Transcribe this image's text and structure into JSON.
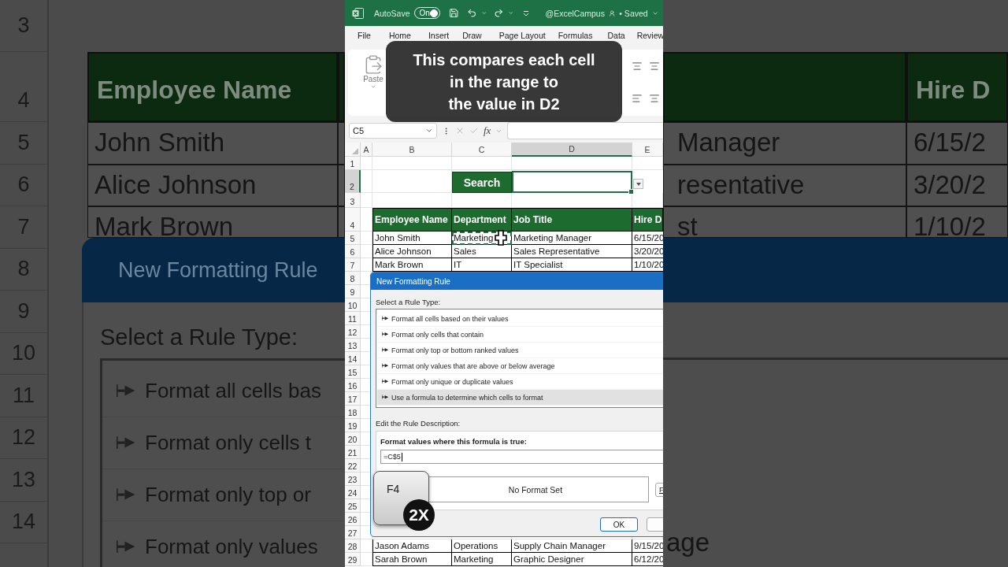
{
  "backdrop_left": {
    "row_numbers": [
      "3",
      "4",
      "5",
      "6",
      "7",
      "8",
      "9",
      "10",
      "11",
      "12",
      "13",
      "14"
    ],
    "table_header": "Employee Name",
    "table_rows": [
      "John Smith",
      "Alice Johnson",
      "Mark Brown"
    ],
    "dialog_title": "New Formatting Rule",
    "rule_type_label": "Select a Rule Type:",
    "rule_types": [
      "Format all cells bas",
      "Format only cells t",
      "Format only top or",
      "Format only values"
    ]
  },
  "title_bar": {
    "autosave_label": "AutoSave",
    "autosave_on": true,
    "autosave_state": "On",
    "account": "@ExcelCampus",
    "save_status": "• Saved"
  },
  "menu": [
    "File",
    "Home",
    "Insert",
    "Draw",
    "Page Layout",
    "Formulas",
    "Data",
    "Review"
  ],
  "ribbon": {
    "paste": "Paste"
  },
  "caption": "This compares each cell\nin the range to\nthe value in D2",
  "sheet": {
    "name_box": "C5",
    "function_label": "fx",
    "columns": [
      {
        "label": "A",
        "selected": false
      },
      {
        "label": "B",
        "selected": false
      },
      {
        "label": "C",
        "selected": false
      },
      {
        "label": "D",
        "selected": true
      },
      {
        "label": "E",
        "selected": false
      }
    ],
    "rows": [
      {
        "number": "1",
        "kind": "blank",
        "selected": false
      },
      {
        "number": "2",
        "kind": "search",
        "selected": true,
        "label": "Search"
      },
      {
        "number": "3",
        "kind": "blank",
        "selected": false
      },
      {
        "number": "4",
        "kind": "header",
        "selected": false,
        "cells": [
          "Employee Name",
          "Department",
          "Job Title",
          "Hire D"
        ]
      },
      {
        "number": "5",
        "kind": "data",
        "selected": false,
        "cells": [
          {
            "text": "John Smith",
            "marquee": false
          },
          {
            "text": "Marketing",
            "marquee": true
          },
          {
            "text": "Marketing Manager",
            "marquee": false
          },
          {
            "text": "6/15/20",
            "marquee": false
          }
        ]
      },
      {
        "number": "6",
        "kind": "data",
        "selected": false,
        "cells": [
          {
            "text": "Alice Johnson",
            "marquee": false
          },
          {
            "text": "Sales",
            "marquee": false
          },
          {
            "text": "Sales Representative",
            "marquee": false
          },
          {
            "text": "3/20/20",
            "marquee": false
          }
        ]
      },
      {
        "number": "7",
        "kind": "data",
        "selected": false,
        "cells": [
          {
            "text": "Mark Brown",
            "marquee": false
          },
          {
            "text": "IT",
            "marquee": false
          },
          {
            "text": "IT Specialist",
            "marquee": false
          },
          {
            "text": "1/10/20",
            "marquee": false
          }
        ]
      },
      {
        "number": "8",
        "kind": "blank",
        "selected": false
      },
      {
        "number": "9",
        "kind": "blank",
        "selected": false
      },
      {
        "number": "10",
        "kind": "blank",
        "selected": false
      },
      {
        "number": "11",
        "kind": "blank",
        "selected": false
      },
      {
        "number": "12",
        "kind": "blank",
        "selected": false
      },
      {
        "number": "13",
        "kind": "blank",
        "selected": false
      },
      {
        "number": "14",
        "kind": "blank",
        "selected": false
      },
      {
        "number": "15",
        "kind": "blank",
        "selected": false
      },
      {
        "number": "16",
        "kind": "blank",
        "selected": false
      },
      {
        "number": "17",
        "kind": "blank",
        "selected": false
      },
      {
        "number": "18",
        "kind": "blank",
        "selected": false
      },
      {
        "number": "19",
        "kind": "blank",
        "selected": false
      },
      {
        "number": "20",
        "kind": "blank",
        "selected": false
      },
      {
        "number": "21",
        "kind": "blank",
        "selected": false
      },
      {
        "number": "22",
        "kind": "blank",
        "selected": false
      },
      {
        "number": "23",
        "kind": "blank",
        "selected": false
      },
      {
        "number": "24",
        "kind": "blank",
        "selected": false
      },
      {
        "number": "25",
        "kind": "blank",
        "selected": false
      },
      {
        "number": "26",
        "kind": "blank",
        "selected": false
      },
      {
        "number": "27",
        "kind": "blank",
        "selected": false
      },
      {
        "number": "28",
        "kind": "data",
        "selected": false,
        "cells": [
          {
            "text": "Jason Adams",
            "marquee": false
          },
          {
            "text": "Operations",
            "marquee": false
          },
          {
            "text": "Supply Chain Manager",
            "marquee": false
          },
          {
            "text": "9/15/20",
            "marquee": false
          }
        ]
      },
      {
        "number": "29",
        "kind": "data",
        "selected": false,
        "cells": [
          {
            "text": "Sarah Brown",
            "marquee": false
          },
          {
            "text": "Marketing",
            "marquee": false
          },
          {
            "text": "Graphic Designer",
            "marquee": false
          },
          {
            "text": "6/12/20",
            "marquee": false
          }
        ]
      }
    ]
  },
  "dialog": {
    "title": "New Formatting Rule",
    "rule_type_label": "Select a Rule Type:",
    "rule_types": [
      {
        "label": "Format all cells based on their values",
        "selected": false
      },
      {
        "label": "Format only cells that contain",
        "selected": false
      },
      {
        "label": "Format only top or bottom ranked values",
        "selected": false
      },
      {
        "label": "Format only values that are above or below average",
        "selected": false
      },
      {
        "label": "Format only unique or duplicate values",
        "selected": false
      },
      {
        "label": "Use a formula to determine which cells to format",
        "selected": true
      }
    ],
    "description_label": "Edit the Rule Description:",
    "formula_label": "Format values where this formula is true:",
    "formula": "=C$5",
    "preview": "No Format Set",
    "format_button": "F",
    "ok_button": "OK"
  },
  "key_overlay": {
    "key": "F4",
    "badge": "2X"
  },
  "backdrop_right": {
    "table_header": "Hire D",
    "table_rows": [
      {
        "column_1": "Manager",
        "column_2": "6/15/2"
      },
      {
        "column_1": "resentative",
        "column_2": "3/20/2"
      },
      {
        "column_1": "st",
        "column_2": "1/10/2"
      }
    ],
    "bottom_text": "age"
  }
}
